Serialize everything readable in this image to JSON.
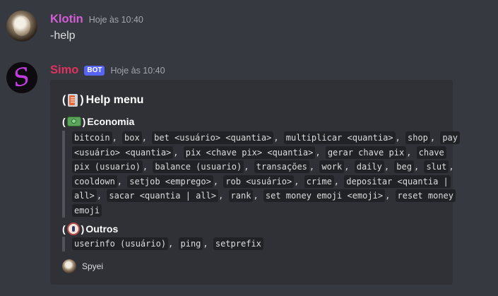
{
  "messages": [
    {
      "username": "Klotin",
      "timestamp": "Hoje às 10:40",
      "content": "-help",
      "name_color": "#d15fd6"
    },
    {
      "username": "Simo",
      "bot_tag": "BOT",
      "timestamp": "Hoje às 10:40",
      "name_color": "#e0315f",
      "avatar_letter": "S"
    }
  ],
  "embed": {
    "title": "Help menu",
    "title_icon": "book-icon",
    "fields": [
      {
        "name": "Economia",
        "icon": "money-icon",
        "lines": [
          [
            "bitcoin",
            ", ",
            "box",
            ", ",
            "bet <usuário> <quantia>",
            ", ",
            "multiplicar <quantia>",
            ", ",
            "shop",
            ", ",
            "pay"
          ],
          [
            "<usuário> <quantia>",
            ", ",
            "pix <chave pix> <quantia>",
            ", ",
            "gerar chave pix",
            ", ",
            "chave"
          ],
          [
            "pix (usuario)",
            ", ",
            "balance (usuario)",
            ", ",
            "transações",
            ", ",
            "work",
            ", ",
            "daily",
            ", ",
            "beg",
            ", ",
            "slut",
            ","
          ],
          [
            "cooldown",
            ", ",
            "setjob <emprego>",
            ", ",
            "rob <usuário>",
            ", ",
            "crime",
            ", ",
            "depositar <quantia |"
          ],
          [
            "all>",
            ", ",
            "sacar <quantia | all>",
            ", ",
            "rank",
            ", ",
            "set money emoji <emoji>",
            ", ",
            "reset money"
          ],
          [
            "emoji"
          ]
        ]
      },
      {
        "name": "Outros",
        "icon": "seal-icon",
        "lines": [
          [
            "userinfo (usuário)",
            ", ",
            "ping",
            ", ",
            "setprefix"
          ]
        ]
      }
    ],
    "footer": {
      "text": "Spyei"
    }
  },
  "colors": {
    "background": "#36393f",
    "embed_background": "#2f3136",
    "code_background": "#202225",
    "bot_tag": "#5865f2"
  }
}
